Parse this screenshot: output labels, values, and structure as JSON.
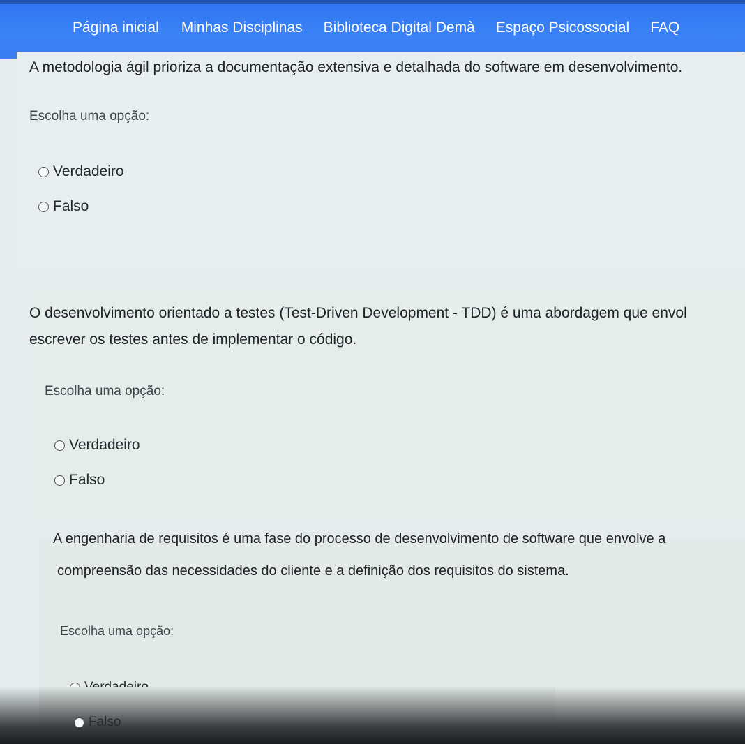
{
  "nav": {
    "links": [
      "Página inicial",
      "Minhas Disciplinas",
      "Biblioteca Digital Demà",
      "Espaço Psicossocial",
      "FAQ"
    ]
  },
  "questions": [
    {
      "statement": "A metodologia ágil prioriza a documentação extensiva e detalhada do software em desenvolvimento.",
      "prompt": "Escolha uma opção:",
      "options": [
        "Verdadeiro",
        "Falso"
      ]
    },
    {
      "statement_line1": "O desenvolvimento orientado a testes (Test-Driven Development - TDD) é uma abordagem que envol",
      "statement_line2": "escrever os testes antes de implementar o código.",
      "prompt": "Escolha uma opção:",
      "options": [
        "Verdadeiro",
        "Falso"
      ]
    },
    {
      "statement_line1": "A engenharia de requisitos é uma fase do processo de desenvolvimento de software que envolve a",
      "statement_line2": "compreensão das necessidades do cliente e a definição dos requisitos do sistema.",
      "prompt": "Escolha uma opção:",
      "options": [
        "Verdadeiro",
        "Falso"
      ]
    }
  ],
  "colors": {
    "navbar": "#3b82f6",
    "page_bg": "#e6ebee",
    "text": "#1d2226"
  }
}
